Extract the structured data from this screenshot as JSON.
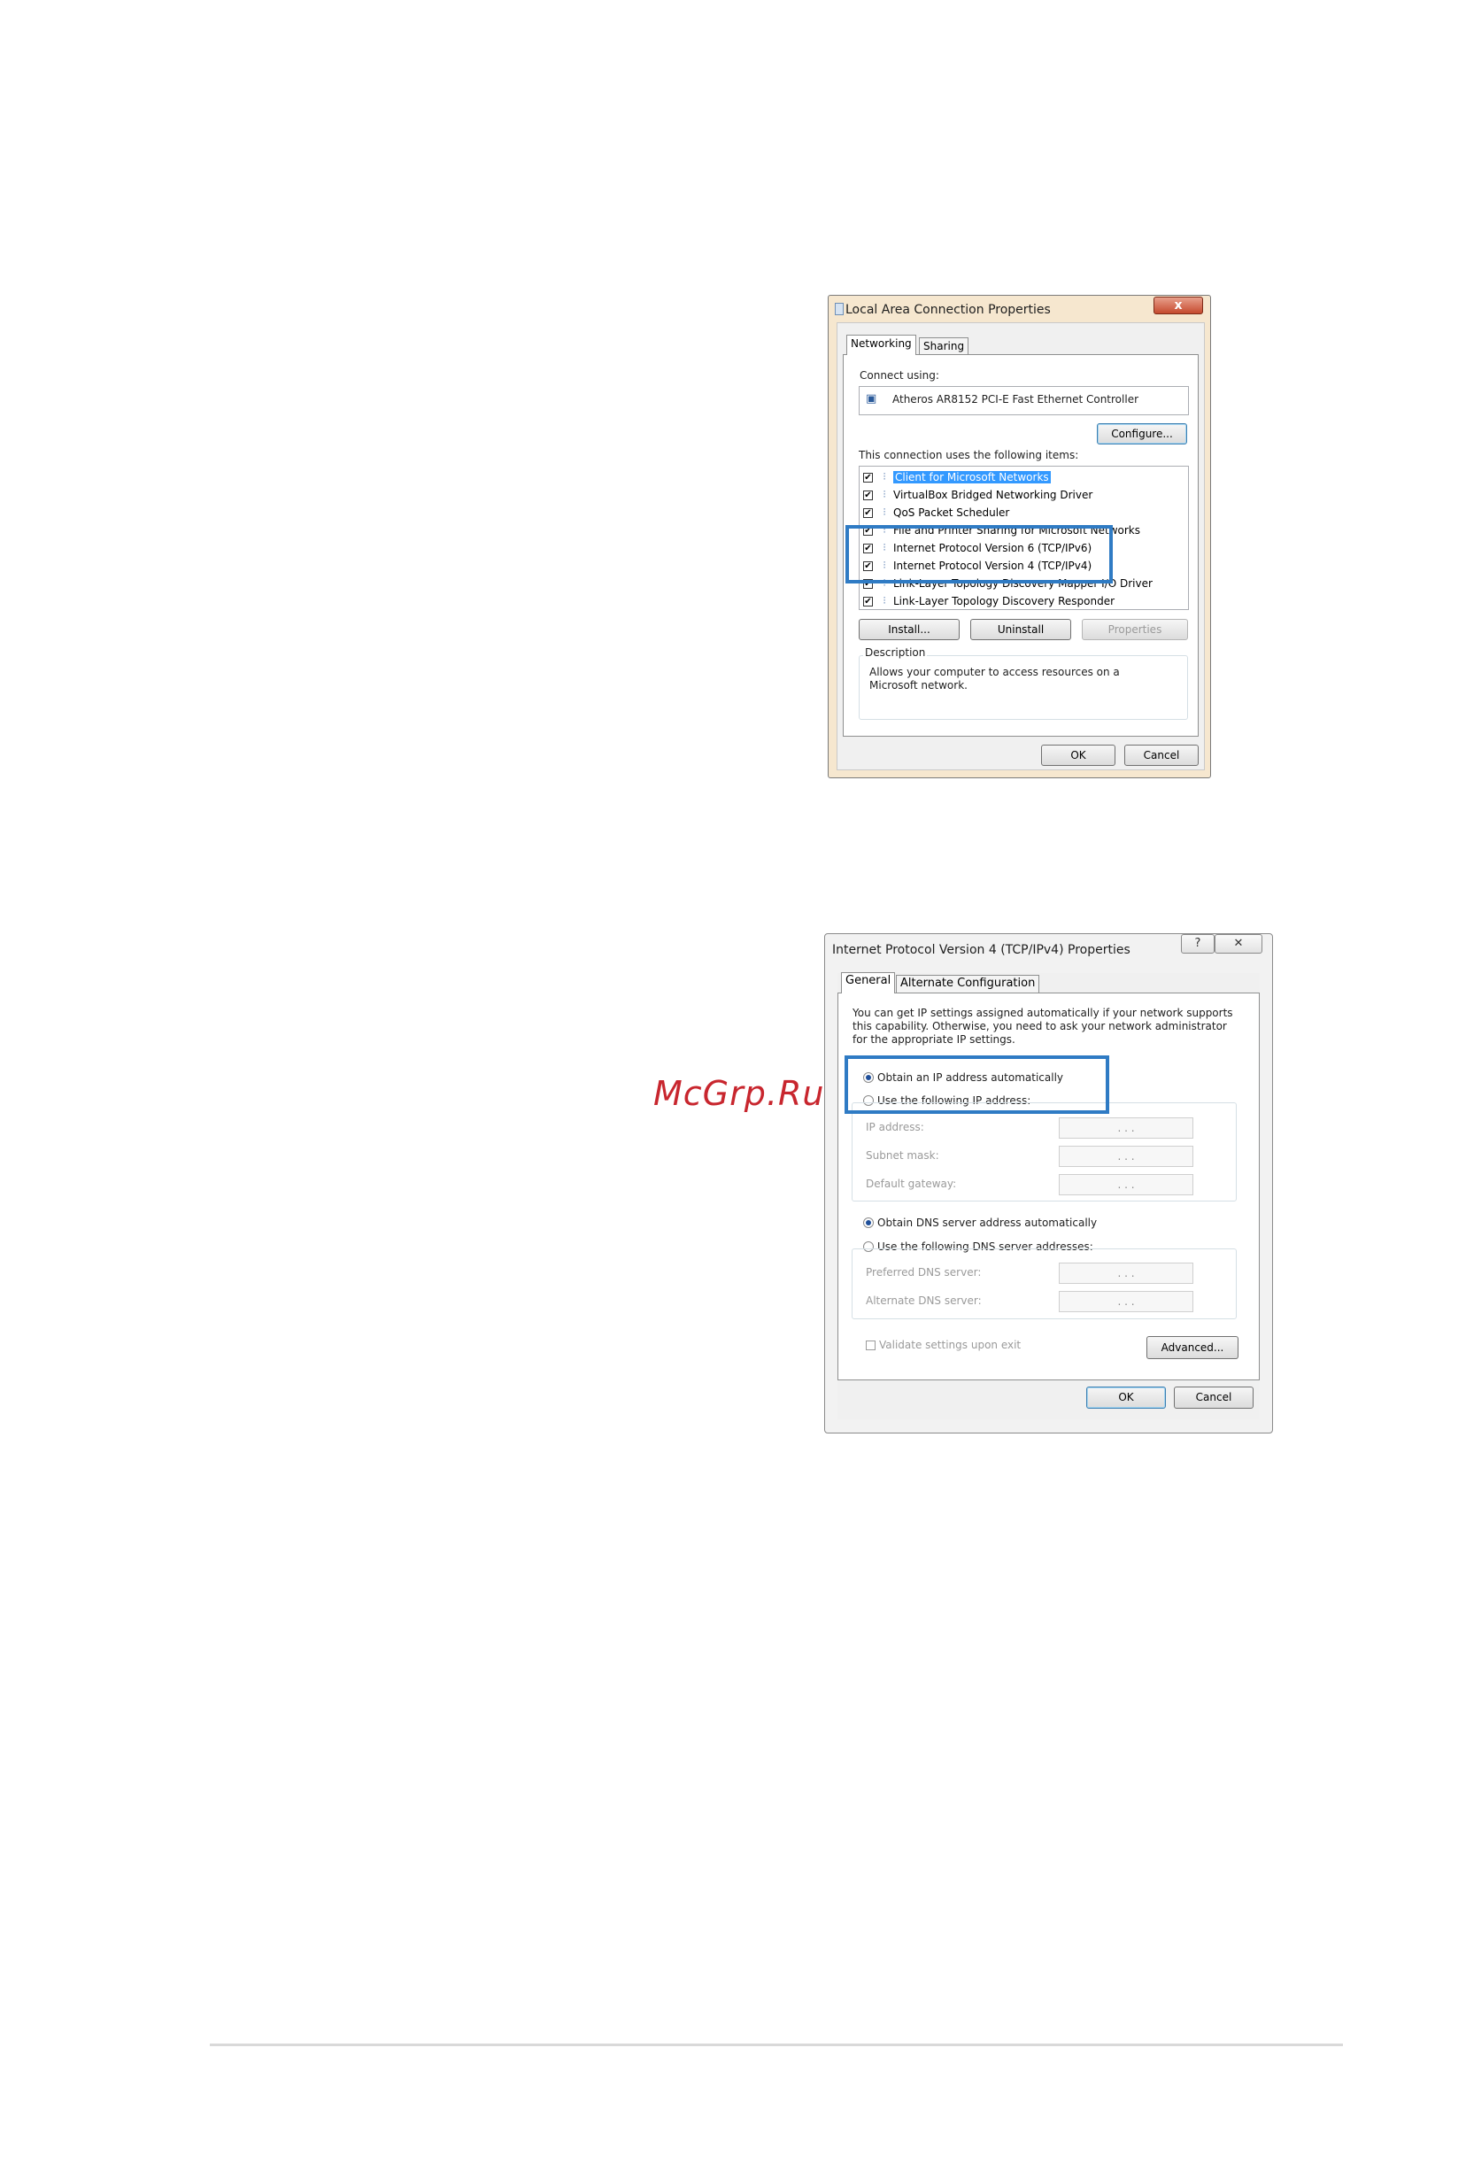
{
  "watermark": "McGrp.Ru",
  "dialog1": {
    "title": "Local Area Connection Properties",
    "close_glyph": "x",
    "tabs": [
      "Networking",
      "Sharing"
    ],
    "connect_using_label": "Connect using:",
    "adapter": "Atheros AR8152 PCI-E Fast Ethernet Controller",
    "configure_button": "Configure...",
    "items_label": "This connection uses the following items:",
    "items": [
      {
        "label": "Client for Microsoft Networks",
        "checked": true,
        "selected": true
      },
      {
        "label": "VirtualBox Bridged Networking Driver",
        "checked": true
      },
      {
        "label": "QoS Packet Scheduler",
        "checked": true
      },
      {
        "label": "File and Printer Sharing for Microsoft Networks",
        "checked": true
      },
      {
        "label": "Internet Protocol Version 6 (TCP/IPv6)",
        "checked": true
      },
      {
        "label": "Internet Protocol Version 4 (TCP/IPv4)",
        "checked": true
      },
      {
        "label": "Link-Layer Topology Discovery Mapper I/O Driver",
        "checked": true
      },
      {
        "label": "Link-Layer Topology Discovery Responder",
        "checked": true
      }
    ],
    "install_button": "Install...",
    "uninstall_button": "Uninstall",
    "properties_button": "Properties",
    "description_label": "Description",
    "description_text": "Allows your computer to access resources on a Microsoft network.",
    "ok_button": "OK",
    "cancel_button": "Cancel",
    "check_glyph": "✔"
  },
  "dialog2": {
    "title": "Internet Protocol Version 4 (TCP/IPv4) Properties",
    "help_glyph": "?",
    "close_glyph": "✕",
    "tabs": [
      "General",
      "Alternate Configuration"
    ],
    "intro": "You can get IP settings assigned automatically if your network supports this capability. Otherwise, you need to ask your network administrator for the appropriate IP settings.",
    "radio_auto_ip": "Obtain an IP address automatically",
    "radio_manual_ip": "Use the following IP address:",
    "ip_address_label": "IP address:",
    "subnet_mask_label": "Subnet mask:",
    "default_gateway_label": "Default gateway:",
    "radio_auto_dns": "Obtain DNS server address automatically",
    "radio_manual_dns": "Use the following DNS server addresses:",
    "preferred_dns_label": "Preferred DNS server:",
    "alternate_dns_label": "Alternate DNS server:",
    "ip_dots": ".  .  .",
    "validate_label": "Validate settings upon exit",
    "advanced_button": "Advanced...",
    "ok_button": "OK",
    "cancel_button": "Cancel"
  }
}
